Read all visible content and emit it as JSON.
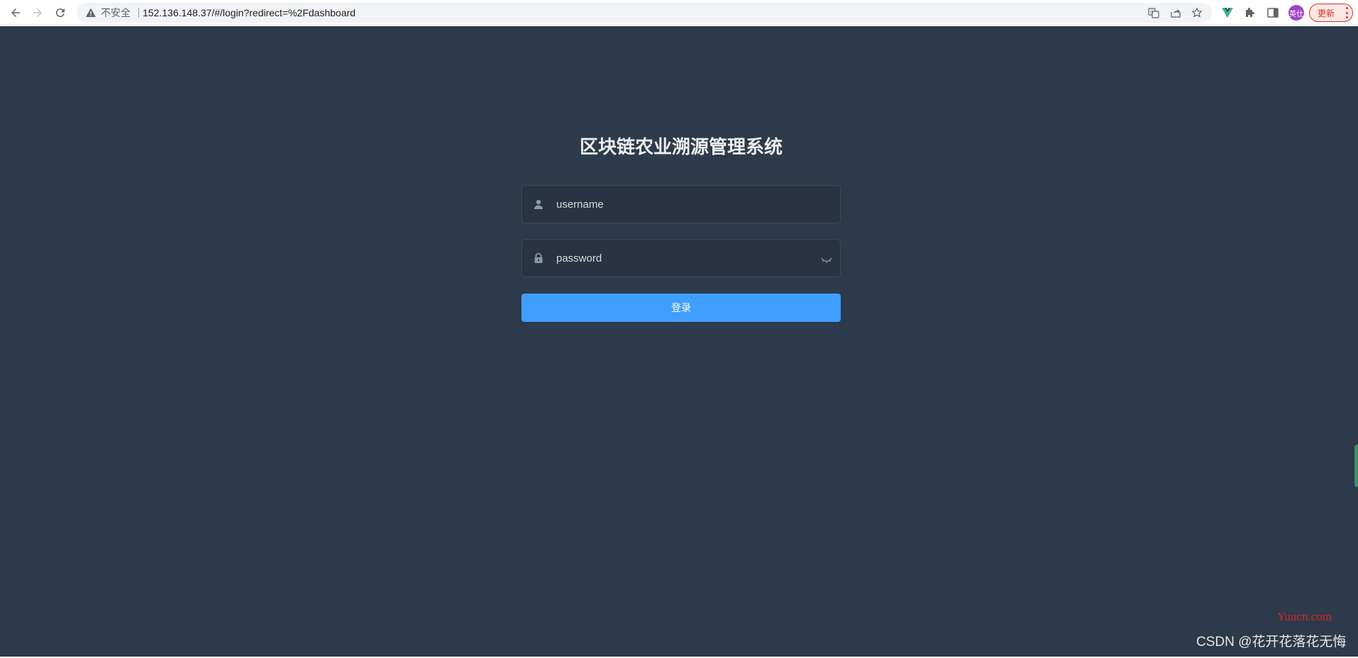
{
  "browser": {
    "insecure_label": "不安全",
    "url": "152.136.148.37/#/login?redirect=%2Fdashboard",
    "profile_initials": "英仕",
    "update_label": "更新"
  },
  "login": {
    "title": "区块链农业溯源管理系统",
    "username_placeholder": "username",
    "password_placeholder": "password",
    "submit_label": "登录"
  },
  "watermarks": {
    "site": "Yuucn.com",
    "csdn": "CSDN @花开花落花无悔"
  },
  "colors": {
    "page_background": "#2d3a4b",
    "button_primary": "#409eff",
    "title_text": "#eeeeee"
  },
  "icons": {
    "back": "back-arrow-icon",
    "forward": "forward-arrow-icon",
    "reload": "reload-icon",
    "warning": "warning-icon",
    "translate": "translate-icon",
    "share": "share-icon",
    "bookmark": "star-icon",
    "vue_devtools": "vue-icon",
    "extensions": "puzzle-icon",
    "side_panel": "side-panel-icon",
    "user": "user-icon",
    "lock": "lock-icon",
    "eye_closed": "eye-closed-icon"
  }
}
